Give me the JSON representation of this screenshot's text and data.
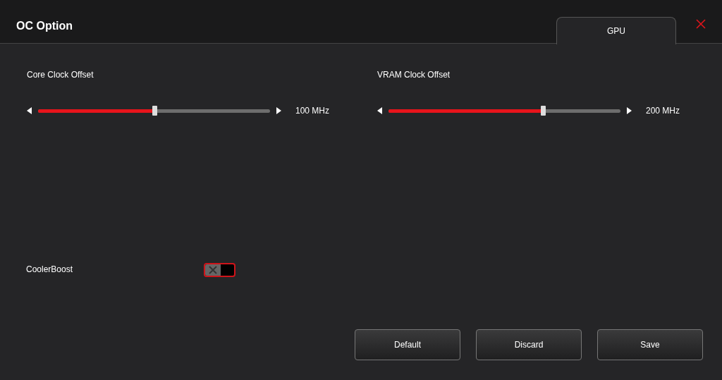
{
  "window": {
    "title": "OC Option"
  },
  "tabs": [
    {
      "label": "GPU",
      "selected": true
    }
  ],
  "sliders": [
    {
      "label": "Core Clock Offset",
      "level": 0.5,
      "reading": "100 MHz"
    },
    {
      "label": "VRAM Clock Offset",
      "level": 0.665,
      "reading": "200 MHz"
    }
  ],
  "toggle": {
    "label": "CoolerBoost",
    "on": false
  },
  "buttons": [
    "Default",
    "Discard",
    "Save"
  ]
}
